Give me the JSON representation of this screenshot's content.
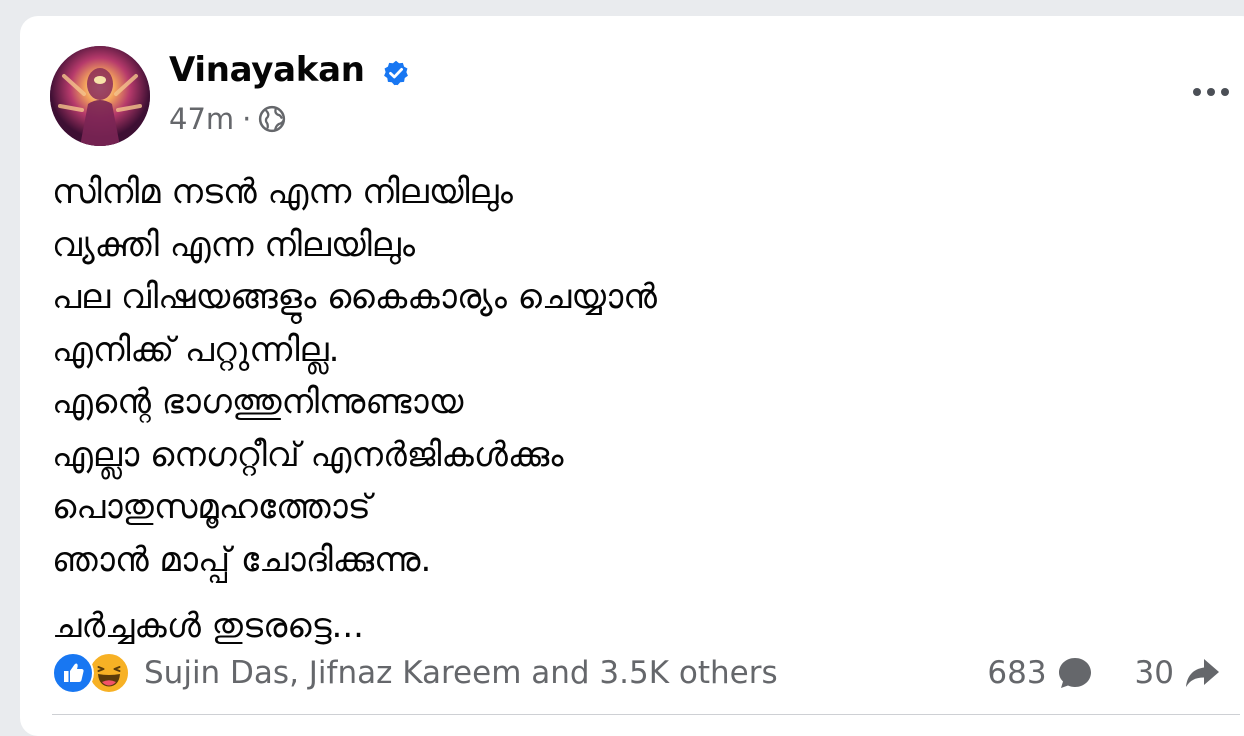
{
  "post": {
    "author": "Vinayakan",
    "verified": true,
    "time": "47m",
    "separator": "·",
    "audience_icon": "globe-icon",
    "menu_icon": "more-options-icon",
    "lines": [
      "സിനിമ നടൻ എന്ന നിലയിലും",
      "വ്യക്തി എന്ന നിലയിലും",
      "പല വിഷയങ്ങളും കൈകാര്യം ചെയ്യാൻ",
      "എനിക്ക് പറ്റുന്നില്ല.",
      "എന്റെ ഭാഗത്തുനിന്നുണ്ടായ",
      "എല്ലാ നെഗറ്റീവ് എനർജികൾക്കും",
      "പൊതുസമൂഹത്തോട്",
      "ഞാൻ മാപ്പ് ചോദിക്കുന്നു."
    ],
    "closing": "ചർച്ചകൾ തുടരട്ടെ..."
  },
  "reactions": {
    "icons": [
      "like-icon",
      "haha-icon"
    ],
    "names": "Sujin Das, Jifnaz Kareem and 3.5K others"
  },
  "stats": {
    "comments": "683",
    "shares": "30"
  },
  "colors": {
    "verified": "#1877f2",
    "like": "#1877f2",
    "haha": "#f7b125",
    "secondary_text": "#65676b",
    "primary_text": "#050505"
  }
}
